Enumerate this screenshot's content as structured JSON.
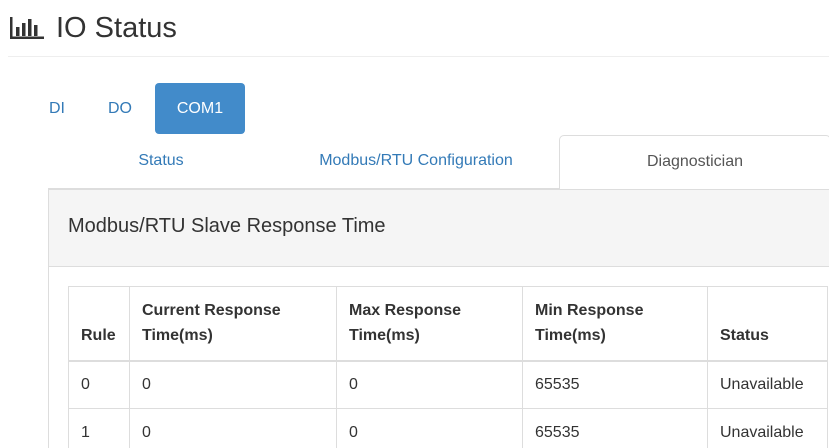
{
  "page": {
    "title": "IO Status",
    "icon": "bar-chart-icon"
  },
  "pills": [
    {
      "label": "DI",
      "active": false
    },
    {
      "label": "DO",
      "active": false
    },
    {
      "label": "COM1",
      "active": true
    }
  ],
  "subtabs": [
    {
      "label": "Status",
      "active": false
    },
    {
      "label": "Modbus/RTU Configuration",
      "active": false
    },
    {
      "label": "Diagnostician",
      "active": true
    }
  ],
  "panel": {
    "title": "Modbus/RTU Slave Response Time"
  },
  "table": {
    "headers": {
      "rule": "Rule",
      "current_1": "Current Response",
      "current_2": "Time(ms)",
      "max_1": "Max Response",
      "max_2": "Time(ms)",
      "min_1": "Min Response",
      "min_2": "Time(ms)",
      "status": "Status"
    },
    "rows": [
      {
        "rule": "0",
        "current": "0",
        "max": "0",
        "min": "65535",
        "status": "Unavailable"
      },
      {
        "rule": "1",
        "current": "0",
        "max": "0",
        "min": "65535",
        "status": "Unavailable"
      }
    ]
  },
  "colors": {
    "active_pill": "#428bca",
    "link": "#337ab7",
    "border": "#dddddd",
    "panel_heading": "#f5f5f5"
  }
}
